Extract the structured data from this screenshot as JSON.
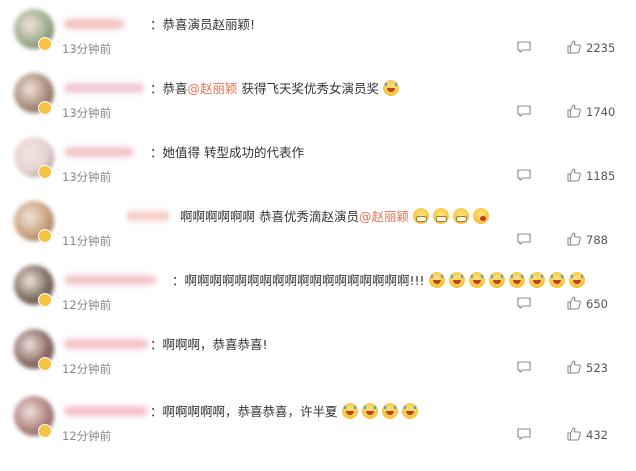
{
  "comments": [
    {
      "text_parts": [
        {
          "t": "：恭喜演员赵丽颖!",
          "type": "plain"
        }
      ],
      "time": "13分钟前",
      "likes": "2235",
      "avatar_color": "#9cab8b",
      "name_color": "#f2b9b7",
      "emojis": []
    },
    {
      "text_parts": [
        {
          "t": "：恭喜",
          "type": "plain"
        },
        {
          "t": "@赵丽颖",
          "type": "mention"
        },
        {
          "t": " 获得飞天奖优秀女演员奖",
          "type": "plain"
        }
      ],
      "time": "13分钟前",
      "likes": "1740",
      "avatar_color": "#a68a77",
      "name_color": "#f0c2cd",
      "emojis": [
        "crying-face-icon"
      ]
    },
    {
      "text_parts": [
        {
          "t": "：她值得 转型成功的代表作",
          "type": "plain"
        }
      ],
      "time": "13分钟前",
      "likes": "1185",
      "avatar_color": "#e7d3d3",
      "name_color": "#f4bfc2",
      "emojis": []
    },
    {
      "text_parts": [
        {
          "t": "啊啊啊啊啊啊 恭喜优秀滴赵演员",
          "type": "plain"
        },
        {
          "t": "@赵丽颖",
          "type": "mention"
        }
      ],
      "time": "11分钟前",
      "likes": "788",
      "avatar_color": "#c9a07a",
      "name_color": "#f3c9c2",
      "emojis": [
        "grinning-face-icon",
        "grinning-face-icon",
        "grinning-face-icon",
        "winking-face-icon"
      ]
    },
    {
      "text_parts": [
        {
          "t": "：啊啊啊啊啊啊啊啊啊啊啊啊啊啊啊啊啊啊!!!",
          "type": "plain"
        }
      ],
      "time": "12分钟前",
      "likes": "650",
      "avatar_color": "#7a6b60",
      "name_color": "#f1c1c6",
      "emojis": [
        "screaming-face-icon",
        "screaming-face-icon",
        "screaming-face-icon",
        "screaming-face-icon",
        "screaming-face-icon",
        "screaming-face-icon",
        "screaming-face-icon",
        "screaming-face-icon"
      ]
    },
    {
      "text_parts": [
        {
          "t": "：啊啊啊，恭喜恭喜!",
          "type": "plain"
        }
      ],
      "time": "12分钟前",
      "likes": "523",
      "avatar_color": "#8a6a66",
      "name_color": "#f3b8c0",
      "emojis": []
    },
    {
      "text_parts": [
        {
          "t": "：啊啊啊啊啊，恭喜恭喜，许半夏",
          "type": "plain"
        }
      ],
      "time": "12分钟前",
      "likes": "432",
      "avatar_color": "#b07f80",
      "name_color": "#f5b7c4",
      "emojis": [
        "crying-face-icon",
        "crying-face-icon",
        "crying-face-icon",
        "crying-face-icon"
      ]
    }
  ],
  "icons": {
    "comment": "comment-icon",
    "like": "thumbs-up-icon"
  },
  "colors": {
    "mention": "#eb7350",
    "time": "#888888",
    "badge": "#f6c344"
  }
}
